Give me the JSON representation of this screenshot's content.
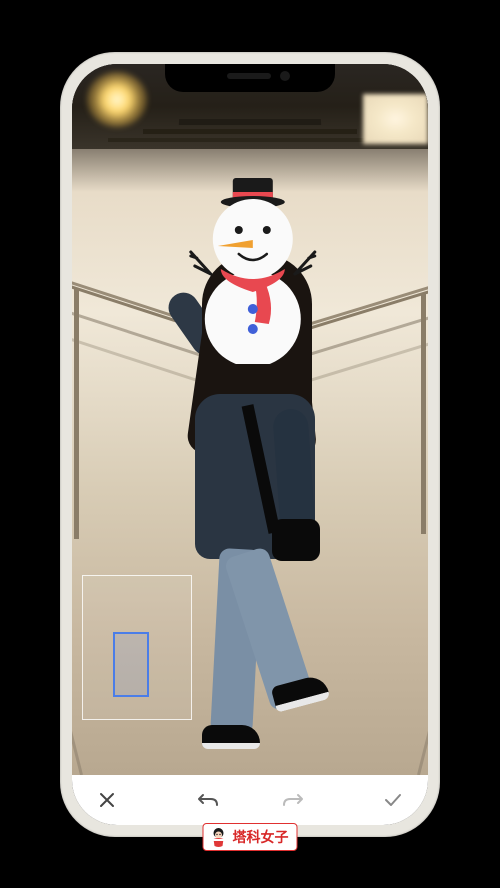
{
  "toolbar": {
    "cancel": "✕",
    "undo": "↶",
    "redo": "↷",
    "confirm": "✓"
  },
  "watermark": {
    "text": "塔科女子"
  },
  "sticker": {
    "name": "snowman"
  },
  "colors": {
    "accent": "#4a7de8",
    "brand": "#d82828"
  }
}
